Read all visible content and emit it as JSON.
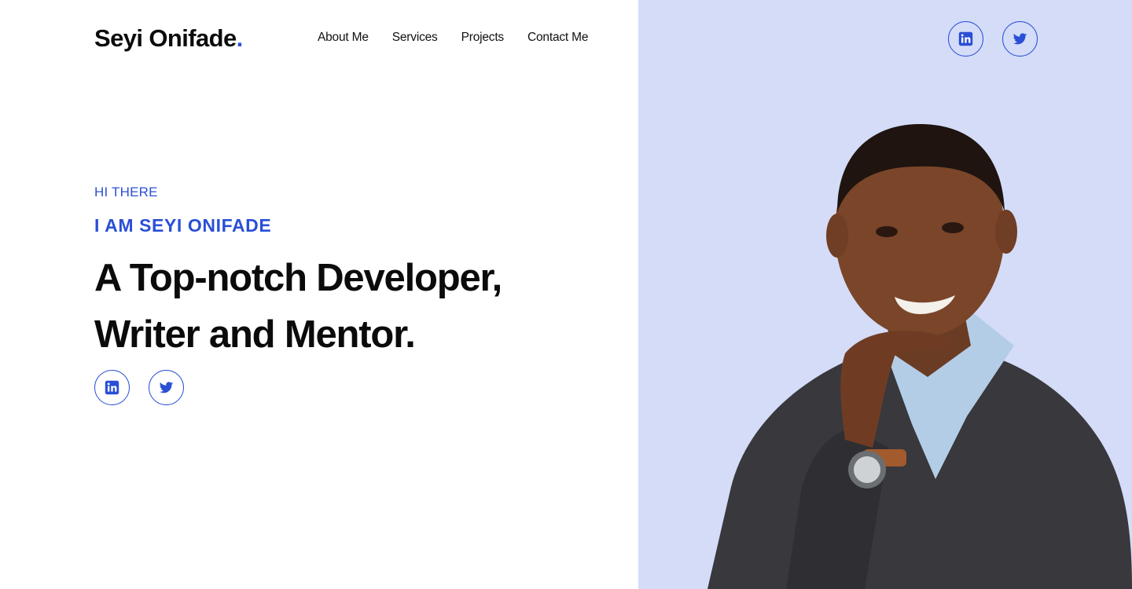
{
  "brand": {
    "name": "Seyi Onifade",
    "dot": ".",
    "accent": "#2a4fd6"
  },
  "nav": {
    "items": [
      "About Me",
      "Services",
      "Projects",
      "Contact Me"
    ]
  },
  "hero": {
    "kicker": "HI THERE",
    "subhead": "I AM SEYI ONIFADE",
    "headline_line1": "A Top-notch Developer,",
    "headline_line2": "Writer and Mentor."
  },
  "social": {
    "icons": [
      "linkedin-icon",
      "twitter-icon"
    ]
  },
  "colors": {
    "accent": "#2a4fd6",
    "panel": "#d4dcf8",
    "text": "#0b0b0b"
  }
}
